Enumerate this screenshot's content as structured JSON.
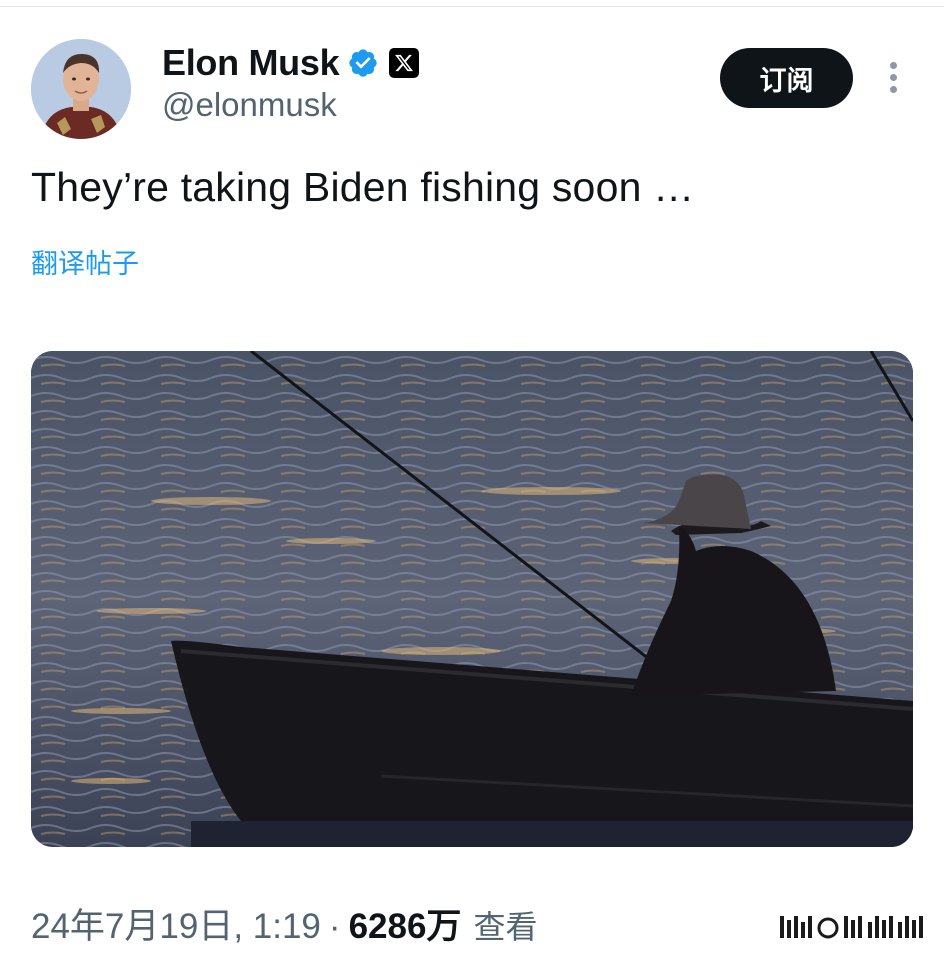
{
  "post": {
    "author_name": "Elon Musk",
    "author_handle": "@elonmusk",
    "subscribe_label": "订阅",
    "text": "They’re taking Biden fishing soon …",
    "translate_label": "翻译帖子",
    "timestamp": "24年7月19日, 1:19",
    "separator": "·",
    "views_count": "6286万",
    "views_label": "查看"
  },
  "icons": {
    "verified": "verified-badge-icon",
    "affiliate": "x-logo-icon",
    "more": "more-vertical-icon"
  },
  "colors": {
    "accent": "#1d9bf0",
    "text_primary": "#0f1419",
    "text_secondary": "#536471",
    "button_bg": "#0f1419"
  }
}
